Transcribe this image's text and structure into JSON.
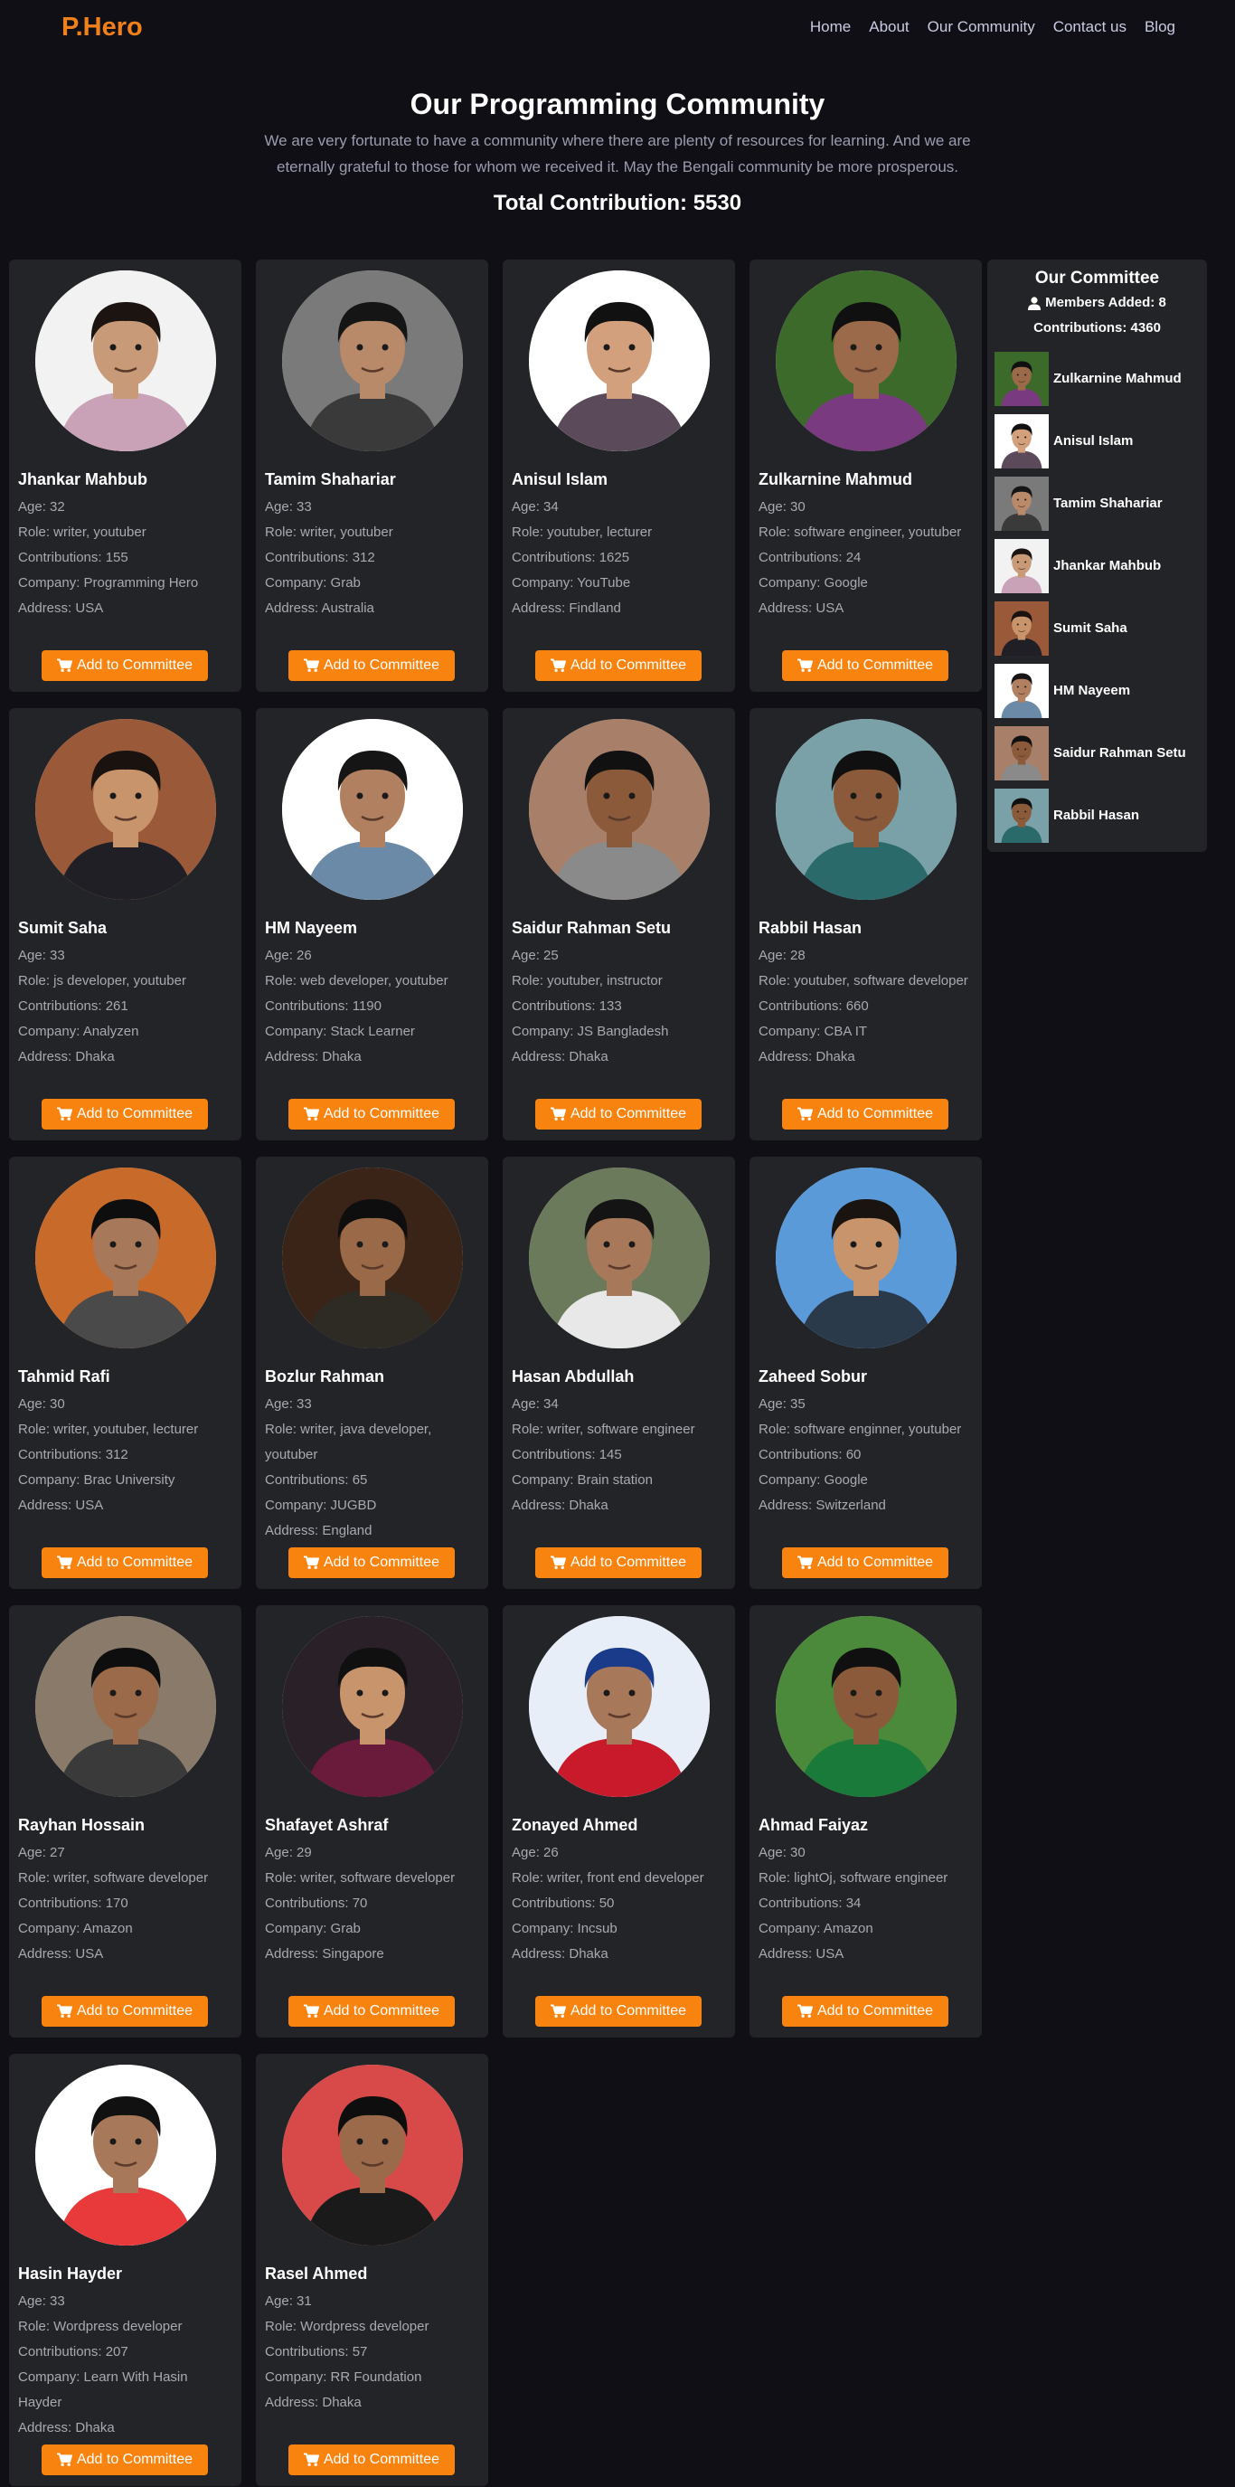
{
  "nav": {
    "logo": "P.Hero",
    "links": [
      "Home",
      "About",
      "Our Community",
      "Contact us",
      "Blog"
    ]
  },
  "hero": {
    "title": "Our Programming Community",
    "description": "We are very fortunate to have a community where there are plenty of resources for learning. And we are eternally grateful to those for whom we received it. May the Bengali community be more prosperous.",
    "total_contribution": "Total Contribution: 5530"
  },
  "button_label": "Add to Committee",
  "colors": {
    "accent": "#f8830f",
    "logo": "#f0801b",
    "background": "#0f0f15",
    "card": "#232427"
  },
  "cards": [
    {
      "name": "Jhankar Mahbub",
      "age": "Age: 32",
      "role": "Role: writer, youtuber",
      "contributions": "Contributions: 155",
      "company": "Company: Programming Hero",
      "address": "Address: USA",
      "bg": "#f2f2f2",
      "skin": "#c89a78",
      "hair": "#1c1410",
      "shirt": "#c9a2b8"
    },
    {
      "name": "Tamim Shahariar",
      "age": "Age: 33",
      "role": "Role: writer, youtuber",
      "contributions": "Contributions: 312",
      "company": "Company: Grab",
      "address": "Address: Australia",
      "bg": "#7a7a7a",
      "skin": "#b88a6a",
      "hair": "#151515",
      "shirt": "#3a3a3a"
    },
    {
      "name": "Anisul Islam",
      "age": "Age: 34",
      "role": "Role: youtuber, lecturer",
      "contributions": "Contributions: 1625",
      "company": "Company: YouTube",
      "address": "Address: Findland",
      "bg": "#ffffff",
      "skin": "#d2a07c",
      "hair": "#111111",
      "shirt": "#5a4a5a"
    },
    {
      "name": "Zulkarnine Mahmud",
      "age": "Age: 30",
      "role": "Role: software engineer, youtuber",
      "contributions": "Contributions: 24",
      "company": "Company: Google",
      "address": "Address: USA",
      "bg": "#3c6a2a",
      "skin": "#9a6a4a",
      "hair": "#101010",
      "shirt": "#7a3a80"
    },
    {
      "name": "Sumit Saha",
      "age": "Age: 33",
      "role": "Role: js developer, youtuber",
      "contributions": "Contributions: 261",
      "company": "Company: Analyzen",
      "address": "Address: Dhaka",
      "bg": "#9a5a3a",
      "skin": "#c8946c",
      "hair": "#1a120e",
      "shirt": "#1f1f25"
    },
    {
      "name": "HM Nayeem",
      "age": "Age: 26",
      "role": "Role: web developer, youtuber",
      "contributions": "Contributions: 1190",
      "company": "Company: Stack Learner",
      "address": "Address: Dhaka",
      "bg": "#ffffff",
      "skin": "#b08060",
      "hair": "#151515",
      "shirt": "#6a8aa8"
    },
    {
      "name": "Saidur Rahman Setu",
      "age": "Age: 25",
      "role": "Role: youtuber, instructor",
      "contributions": "Contributions: 133",
      "company": "Company: JS Bangladesh",
      "address": "Address: Dhaka",
      "bg": "#a8806a",
      "skin": "#8a5a3a",
      "hair": "#111111",
      "shirt": "#8a8a8a"
    },
    {
      "name": "Rabbil Hasan",
      "age": "Age: 28",
      "role": "Role: youtuber, software developer",
      "contributions": "Contributions: 660",
      "company": "Company: CBA IT",
      "address": "Address: Dhaka",
      "bg": "#7aa0a8",
      "skin": "#8a5a3a",
      "hair": "#101010",
      "shirt": "#2a6a6a"
    },
    {
      "name": "Tahmid Rafi",
      "age": "Age: 30",
      "role": "Role: writer, youtuber, lecturer",
      "contributions": "Contributions: 312",
      "company": "Company: Brac University",
      "address": "Address: USA",
      "bg": "#c86a2a",
      "skin": "#a8785a",
      "hair": "#0e0e0e",
      "shirt": "#4a4a4a"
    },
    {
      "name": "Bozlur Rahman",
      "age": "Age: 33",
      "role": "Role: writer, java developer, youtuber",
      "contributions": "Contributions: 65",
      "company": "Company: JUGBD",
      "address": "Address: England",
      "bg": "#3a2418",
      "skin": "#9a6a48",
      "hair": "#0e0e0e",
      "shirt": "#2e2a24"
    },
    {
      "name": "Hasan Abdullah",
      "age": "Age: 34",
      "role": "Role: writer, software engineer",
      "contributions": "Contributions: 145",
      "company": "Company: Brain station",
      "address": "Address: Dhaka",
      "bg": "#6a7a5a",
      "skin": "#a8785a",
      "hair": "#141414",
      "shirt": "#e8e8e8"
    },
    {
      "name": "Zaheed Sobur",
      "age": "Age: 35",
      "role": "Role: software enginner, youtuber",
      "contributions": "Contributions: 60",
      "company": "Company: Google",
      "address": "Address: Switzerland",
      "bg": "#5a9ad8",
      "skin": "#c8946c",
      "hair": "#1a1410",
      "shirt": "#2a3a4a"
    },
    {
      "name": "Rayhan Hossain",
      "age": "Age: 27",
      "role": "Role: writer, software developer",
      "contributions": "Contributions: 170",
      "company": "Company: Amazon",
      "address": "Address: USA",
      "bg": "#8a7a6a",
      "skin": "#9a6a4a",
      "hair": "#0e0e0e",
      "shirt": "#3a3a3a"
    },
    {
      "name": "Shafayet Ashraf",
      "age": "Age: 29",
      "role": "Role: writer, software developer",
      "contributions": "Contributions: 70",
      "company": "Company: Grab",
      "address": "Address: Singapore",
      "bg": "#2a2028",
      "skin": "#c8946c",
      "hair": "#101010",
      "shirt": "#6a1a3a"
    },
    {
      "name": "Zonayed Ahmed",
      "age": "Age: 26",
      "role": "Role: writer, front end developer",
      "contributions": "Contributions: 50",
      "company": "Company: Incsub",
      "address": "Address: Dhaka",
      "bg": "#e8eef8",
      "skin": "#a8785a",
      "hair": "#1a3a8a",
      "shirt": "#c81a2a"
    },
    {
      "name": "Ahmad Faiyaz",
      "age": "Age: 30",
      "role": "Role: lightOj, software engineer",
      "contributions": "Contributions: 34",
      "company": "Company: Amazon",
      "address": "Address: USA",
      "bg": "#4a8a3a",
      "skin": "#8a5a3a",
      "hair": "#101010",
      "shirt": "#1a7a3a"
    },
    {
      "name": "Hasin Hayder",
      "age": "Age: 33",
      "role": "Role: Wordpress developer",
      "contributions": "Contributions: 207",
      "company": "Company: Learn With Hasin Hayder",
      "address": "Address: Dhaka",
      "bg": "#ffffff",
      "skin": "#a8785a",
      "hair": "#111111",
      "shirt": "#e83a3a"
    },
    {
      "name": "Rasel Ahmed",
      "age": "Age: 31",
      "role": "Role: Wordpress developer",
      "contributions": "Contributions: 57",
      "company": "Company: RR Foundation",
      "address": "Address: Dhaka",
      "bg": "#d84a4a",
      "skin": "#9a6a4a",
      "hair": "#0e0e0e",
      "shirt": "#1a1a1a"
    }
  ],
  "committee": {
    "title": "Our Committee",
    "members_added": "Members Added: 8",
    "contributions": "Contributions: 4360",
    "members": [
      {
        "name": "Zulkarnine Mahmud",
        "bg": "#3c6a2a",
        "skin": "#9a6a4a",
        "hair": "#101010",
        "shirt": "#7a3a80"
      },
      {
        "name": "Anisul Islam",
        "bg": "#ffffff",
        "skin": "#d2a07c",
        "hair": "#111111",
        "shirt": "#5a4a5a"
      },
      {
        "name": "Tamim Shahariar",
        "bg": "#7a7a7a",
        "skin": "#b88a6a",
        "hair": "#151515",
        "shirt": "#3a3a3a"
      },
      {
        "name": "Jhankar Mahbub",
        "bg": "#f2f2f2",
        "skin": "#c89a78",
        "hair": "#1c1410",
        "shirt": "#c9a2b8"
      },
      {
        "name": "Sumit Saha",
        "bg": "#9a5a3a",
        "skin": "#c8946c",
        "hair": "#1a120e",
        "shirt": "#1f1f25"
      },
      {
        "name": "HM Nayeem",
        "bg": "#ffffff",
        "skin": "#b08060",
        "hair": "#151515",
        "shirt": "#6a8aa8"
      },
      {
        "name": "Saidur Rahman Setu",
        "bg": "#a8806a",
        "skin": "#8a5a3a",
        "hair": "#111111",
        "shirt": "#8a8a8a"
      },
      {
        "name": "Rabbil Hasan",
        "bg": "#7aa0a8",
        "skin": "#8a5a3a",
        "hair": "#101010",
        "shirt": "#2a6a6a"
      }
    ]
  }
}
